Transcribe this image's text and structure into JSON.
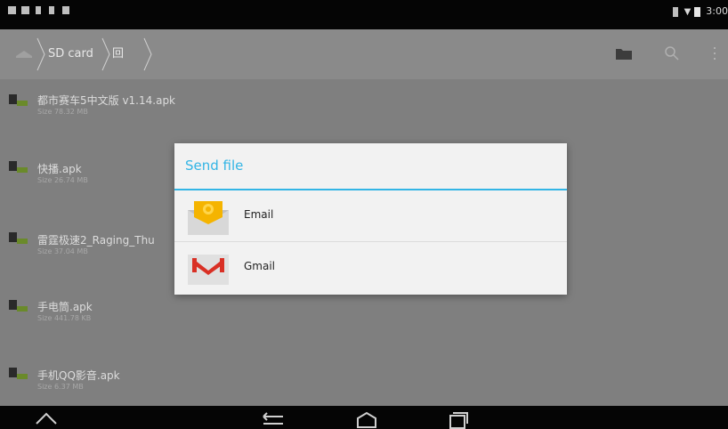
{
  "status_bar": {
    "time": "3:00"
  },
  "breadcrumb": {
    "items": [
      "SD card",
      "回"
    ]
  },
  "files": [
    {
      "name": "都市赛车5中文版 v1.14.apk",
      "size": "Size 78.32 MB"
    },
    {
      "name": "快播.apk",
      "size": "Size 26.74 MB"
    },
    {
      "name": "雷霆极速2_Raging_Thu",
      "size": "Size 37.04 MB"
    },
    {
      "name": "手电筒.apk",
      "size": "Size 441.78 KB"
    },
    {
      "name": "手机QQ影音.apk",
      "size": "Size 6.37 MB"
    }
  ],
  "dialog": {
    "title": "Send file",
    "options": [
      {
        "label": "Email",
        "icon": "email-app-icon"
      },
      {
        "label": "Gmail",
        "icon": "gmail-app-icon"
      }
    ]
  },
  "colors": {
    "accent": "#33b5e5",
    "background": "#7f7f7f"
  }
}
